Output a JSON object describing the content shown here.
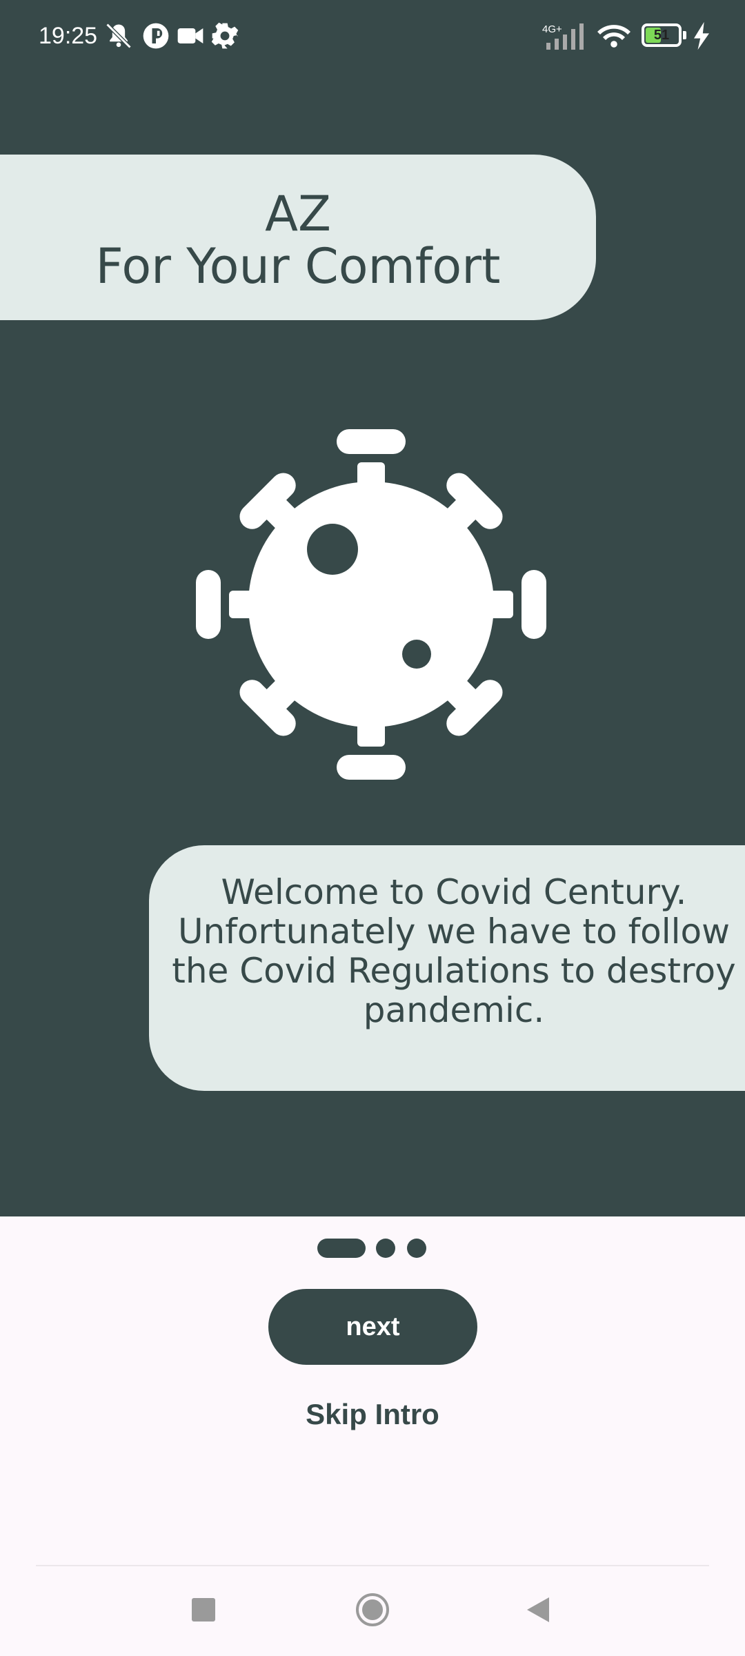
{
  "status_bar": {
    "time": "19:25",
    "network": "4G+",
    "battery_level": "51",
    "battery_fraction": 0.51,
    "icons": [
      "muted-bell-icon",
      "app-icon",
      "video-camera-icon",
      "settings-gear-icon",
      "signal-icon",
      "wifi-icon",
      "battery-icon",
      "charging-bolt-icon"
    ]
  },
  "header": {
    "line1": "AZ",
    "line2": "For Your Comfort"
  },
  "illustration": {
    "icon": "virus-icon"
  },
  "welcome": {
    "text": "Welcome to Covid Century. Unfortunately we have to follow the Covid Regulations to destroy pandemic."
  },
  "pager": {
    "pages": 3,
    "current": 1
  },
  "actions": {
    "next_label": "next",
    "skip_label": "Skip Intro"
  },
  "nav_bar": {
    "icons": [
      "recents-square-icon",
      "home-circle-icon",
      "back-triangle-icon"
    ]
  },
  "colors": {
    "primary": "#374949",
    "card": "#e2ebe9",
    "background": "#fdf8fc"
  }
}
